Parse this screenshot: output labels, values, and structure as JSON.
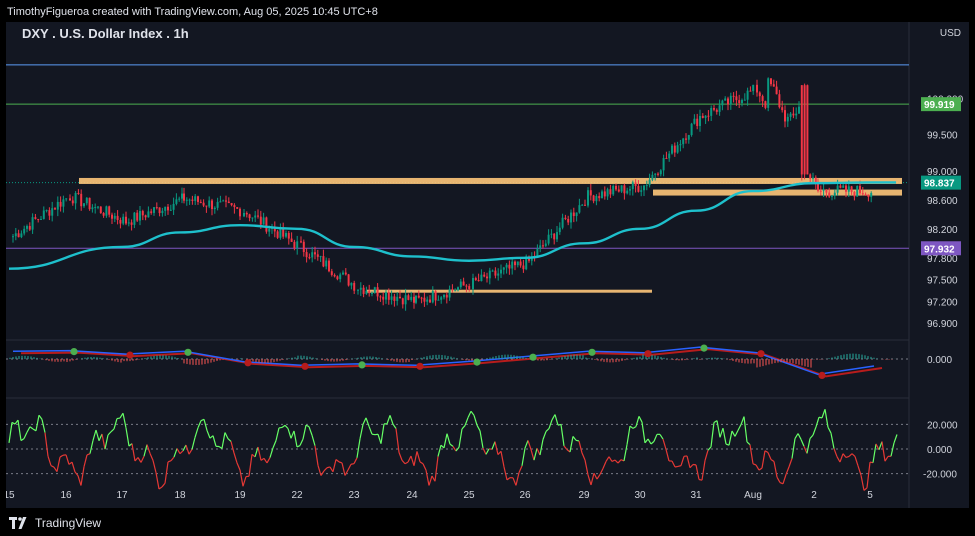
{
  "header": {
    "attribution": "TimothyFigueroa created with TradingView.com, Aug 05, 2025 10:45 UTC+8"
  },
  "legend": {
    "title": "DXY . U.S. Dollar Index . 1h"
  },
  "axis_unit": "USD",
  "footer": {
    "brand": "TradingView"
  },
  "colors": {
    "background": "#131722",
    "up": "#089981",
    "down": "#f23645",
    "ma": "#1ec0cc",
    "zone": "#ffc77a",
    "macd_line": "#2962ff",
    "signal_green": "#4caf50",
    "signal_red": "#b71c1c",
    "osc_up": "#66ff66",
    "osc_down": "#e53935"
  },
  "chart_data": [
    {
      "type": "candlestick",
      "title": "DXY . U.S. Dollar Index . 1h",
      "ylabel": "USD",
      "ylim": [
        96.75,
        100.5
      ],
      "y_ticks": [
        "100.000",
        "99.500",
        "99.000",
        "98.600",
        "98.200",
        "97.800",
        "97.500",
        "97.200",
        "96.900"
      ],
      "x_ticks": [
        "15",
        "16",
        "17",
        "18",
        "19",
        "22",
        "23",
        "24",
        "25",
        "26",
        "29",
        "30",
        "31",
        "Aug",
        "2",
        "5"
      ],
      "price_labels": [
        {
          "value": "99.919",
          "color": "#4caf50"
        },
        {
          "value": "98.837",
          "color": "#089981"
        },
        {
          "value": "97.932",
          "color": "#7e57c2"
        }
      ],
      "horizontal_lines": [
        {
          "value": 100.46,
          "color": "#5b9cf6"
        },
        {
          "value": 99.919,
          "color": "#4caf50"
        },
        {
          "value": 97.932,
          "color": "#7e57c2"
        }
      ],
      "zones": [
        {
          "x_from": "16",
          "x_to": "5",
          "value": 98.86
        },
        {
          "x_from": "30",
          "x_to": "5",
          "value": 98.7
        },
        {
          "x_from": "23",
          "x_to": "29",
          "value": 97.34
        }
      ],
      "anchors": [
        {
          "x": "15",
          "price": 98.1
        },
        {
          "x": "16",
          "price": 98.65
        },
        {
          "x": "17",
          "price": 98.3
        },
        {
          "x": "18",
          "price": 98.62
        },
        {
          "x": "19",
          "price": 98.45
        },
        {
          "x": "22",
          "price": 97.95
        },
        {
          "x": "23",
          "price": 97.4
        },
        {
          "x": "24",
          "price": 97.2
        },
        {
          "x": "25",
          "price": 97.45
        },
        {
          "x": "26",
          "price": 97.75
        },
        {
          "x": "29",
          "price": 98.65
        },
        {
          "x": "30",
          "price": 98.8
        },
        {
          "x": "31",
          "price": 99.75
        },
        {
          "x": "Aug",
          "price": 100.12
        },
        {
          "x": "2",
          "price": 98.72
        },
        {
          "x": "5",
          "price": 98.72
        }
      ],
      "moving_average": [
        {
          "x": "15",
          "price": 97.65
        },
        {
          "x": "17",
          "price": 97.95
        },
        {
          "x": "18",
          "price": 98.15
        },
        {
          "x": "19",
          "price": 98.25
        },
        {
          "x": "22",
          "price": 98.2
        },
        {
          "x": "23",
          "price": 97.95
        },
        {
          "x": "24",
          "price": 97.82
        },
        {
          "x": "25",
          "price": 97.76
        },
        {
          "x": "26",
          "price": 97.8
        },
        {
          "x": "29",
          "price": 98.0
        },
        {
          "x": "30",
          "price": 98.2
        },
        {
          "x": "31",
          "price": 98.45
        },
        {
          "x": "Aug",
          "price": 98.72
        },
        {
          "x": "2",
          "price": 98.83
        },
        {
          "x": "5",
          "price": 98.84
        }
      ]
    },
    {
      "type": "line",
      "ylabel": "",
      "y_ticks": [
        "0.000"
      ],
      "series": [
        {
          "values": [
            0.55,
            0.6,
            0.35,
            0.55,
            -0.2,
            -0.45,
            -0.35,
            -0.45,
            -0.15,
            0.2,
            0.55,
            0.45,
            0.85,
            0.45,
            -1.1,
            -0.5
          ]
        }
      ],
      "x": [
        "15",
        "16",
        "17",
        "18",
        "19",
        "22",
        "23",
        "24",
        "25",
        "26",
        "29",
        "30",
        "31",
        "Aug",
        "2",
        "5"
      ]
    },
    {
      "type": "line",
      "y_ticks": [
        "20.000",
        "0.000",
        "-20.000"
      ],
      "ylim": [
        -35,
        35
      ],
      "x": [
        "15",
        "16",
        "17",
        "18",
        "19",
        "22",
        "23",
        "24",
        "25",
        "26",
        "29",
        "30",
        "31",
        "Aug",
        "2",
        "5"
      ]
    }
  ]
}
